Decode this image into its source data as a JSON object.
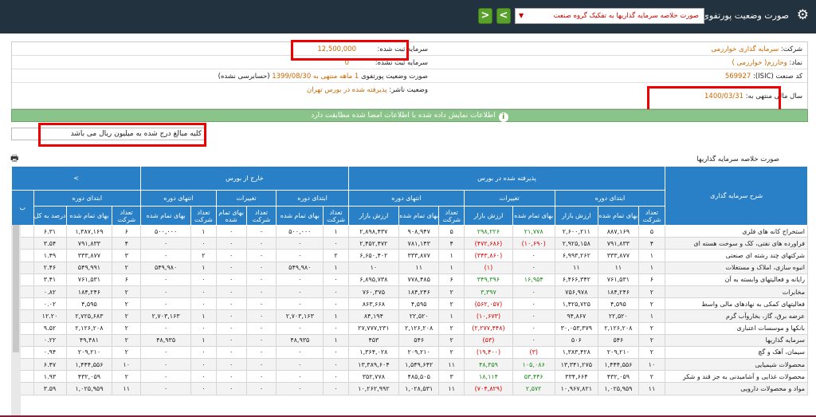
{
  "header": {
    "title": "صورت وضعیت پورتفوی",
    "report_select": "صورت خلاصه سرمایه گذاریها به تفکیک گروه صنعت",
    "prev": "<",
    "next": ">"
  },
  "info": {
    "company_label": "شرکت:",
    "company_value": "سرمایه گذاری خوارزمی",
    "registered_capital_label": "سرمایه ثبت شده:",
    "registered_capital_value": "12,500,000",
    "symbol_label": "نماد:",
    "symbol_value": "وخارزم( خوارزمی )",
    "unregistered_capital_label": "سرمایه ثبت نشده:",
    "unregistered_capital_value": "0",
    "isic_label": "کد صنعت (ISIC):",
    "isic_value": "569927",
    "portfolio_label": "صورت وضعیت پورتفوی",
    "portfolio_value": "1 ماهه منتهی به 1399/08/30",
    "portfolio_note": "(حسابرسی نشده)",
    "fiscal_label": "سال مالی منتهی به:",
    "fiscal_value": "1400/03/31",
    "status_label": "وضعیت ناشر:",
    "status_value": "پذیرفته شده در بورس تهران"
  },
  "notice": "اطلاعات نمایش داده شده با اطلاعات امضا شده مطابقت دارد",
  "unit_note": "کلیه مبالغ درج شده به میلیون ریال می باشد",
  "table_title": "صورت خلاصه سرمایه گذاریها",
  "headers": {
    "desc": "شرح سرمایه گذاری",
    "listed": "پذیرفته شده در بورس",
    "unlisted": "خارج از بورس",
    "start": "ابتدای دوره",
    "changes": "تغییرات",
    "end": "انتهای دوره",
    "count": "تعداد شرکت",
    "cost": "بهای تمام شده",
    "market": "ارزش بازار",
    "pct": "درصد به کل",
    "cut": "ب"
  },
  "rows": [
    {
      "name": "استخراج کانه های فلزی",
      "c": [
        "۵",
        "۸۸۷,۱۶۹",
        "۲,۶۰۰,۲۱۱",
        "۲۱,۷۷۸",
        "۲۹۸,۲۲۶",
        "۵",
        "۹۰۸,۹۴۷",
        "۲,۸۹۸,۴۳۷",
        "۱",
        "۵۰۰,۰۰۰",
        "۰",
        "۰",
        "۱",
        "۵۰۰,۰۰۰",
        "۶",
        "۱,۳۸۷,۱۶۹",
        "۶.۳۱"
      ]
    },
    {
      "name": "فراورده های نفتی، کک و سوخت هسته ای",
      "c": [
        "۴",
        "۷۹۱,۸۳۳",
        "۲,۹۲۵,۱۵۸",
        "(۱۰,۶۹۰)",
        "(۴۷۲,۶۸۶)",
        "۴",
        "۷۸۱,۱۴۳",
        "۲,۴۵۲,۴۷۲",
        "۰",
        "۰",
        "۰",
        "۰",
        "۰",
        "۰",
        "۴",
        "۷۹۱,۸۳۳",
        "۳.۵۴"
      ]
    },
    {
      "name": "شرکتهای چند رشته ای صنعتی",
      "c": [
        "۱",
        "۳۳۳,۸۷۷",
        "۶,۹۹۳,۲۶۲",
        "۰",
        "(۳۴۳,۸۶۰)",
        "۱",
        "۳۳۳,۸۷۷",
        "۶,۶۵۰,۴۰۲",
        "۲",
        "۰",
        "۰",
        "۰",
        "۲",
        "۰",
        "۳",
        "۳۳۳,۸۷۷",
        "۱.۴۹"
      ]
    },
    {
      "name": "انبوه سازی، املاک و مستغلات",
      "c": [
        "۱",
        "۱۱",
        "۱۱",
        "۰",
        "(۱)",
        "۱",
        "۱۱",
        "۱۰",
        "۱",
        "۵۴۹,۹۸۰",
        "۰",
        "۰",
        "۱",
        "۵۴۹,۹۸۰",
        "۲",
        "۵۴۹,۹۹۱",
        "۲.۴۶"
      ]
    },
    {
      "name": "رایانه و فعالیتهای وابسته به آن",
      "c": [
        "۶",
        "۷۶۱,۵۳۱",
        "۶,۴۶۶,۳۴۲",
        "۱۶,۹۵۴",
        "۳۴۹,۳۹۶",
        "۶",
        "۷۷۸,۴۸۵",
        "۶,۸۹۵,۷۳۸",
        "۰",
        "۰",
        "۰",
        "۰",
        "۰",
        "۰",
        "۶",
        "۷۶۱,۵۳۱",
        "۳.۴۱"
      ]
    },
    {
      "name": "مخابرات",
      "c": [
        "۲",
        "۱۸۴,۲۴۶",
        "۷۵۶,۹۷۸",
        "۰",
        "۳,۳۹۷",
        "۲",
        "۱۸۴,۲۴۶",
        "۷۶۰,۳۷۵",
        "۰",
        "۰",
        "۰",
        "۰",
        "۰",
        "۰",
        "۲",
        "۱۸۴,۲۴۶",
        "۰.۸۲"
      ]
    },
    {
      "name": "فعالیتهای کمکی به نهادهای مالی واسط",
      "c": [
        "۲",
        "۴,۵۹۵",
        "۱,۴۲۵,۷۲۵",
        "۰",
        "(۵۶۲,۰۵۷)",
        "۲",
        "۴,۵۹۵",
        "۸۶۳,۶۶۸",
        "۰",
        "۰",
        "۰",
        "۰",
        "۰",
        "۰",
        "۲",
        "۴,۵۹۵",
        "۰.۰۲"
      ]
    },
    {
      "name": "عرضه برق، گاز، بخاروآب گرم",
      "c": [
        "۱",
        "۲۲,۵۲۰",
        "۹۴,۸۶۷",
        "۰",
        "(۱۰,۶۷۳)",
        "۱",
        "۲۲,۵۲۰",
        "۸۴,۱۹۴",
        "۱",
        "۲,۷۰۳,۱۶۳",
        "۰",
        "۰",
        "۱",
        "۲,۷۰۳,۱۶۳",
        "۲",
        "۲,۷۲۵,۶۸۳",
        "۱۲.۲۰"
      ]
    },
    {
      "name": "بانکها و موسسات اعتباری",
      "c": [
        "۲",
        "۲,۱۲۶,۲۰۸",
        "۳۰,۰۵۳,۳۷۹",
        "۰",
        "(۲,۲۷۷,۴۴۸)",
        "۲",
        "۲,۱۲۶,۲۰۸",
        "۲۷,۷۷۷,۲۳۱",
        "۰",
        "۰",
        "۰",
        "۰",
        "۰",
        "۰",
        "۲",
        "۲,۱۲۶,۲۰۸",
        "۹.۵۲"
      ]
    },
    {
      "name": "سرمایه گذاریها",
      "c": [
        "۲",
        "۵۴۶",
        "۵۰۶",
        "۰",
        "(۵۳)",
        "۲",
        "۵۴۶",
        "۴۵۳",
        "۱",
        "۴۸,۹۳۵",
        "۰",
        "۰",
        "۱",
        "۴۸,۹۳۵",
        "۲",
        "۴۹,۴۸۱",
        "۰.۲۲"
      ]
    },
    {
      "name": "سیمان، آهک و گچ",
      "c": [
        "۲",
        "۲۰۹,۲۱۰",
        "۱,۳۸۳,۴۲۸",
        "(۳)",
        "(۱۹,۴۰۰)",
        "۲",
        "۲۰۹,۲۱۰",
        "۱,۳۶۴,۰۲۸",
        "۰",
        "۰",
        "۰",
        "۰",
        "۰",
        "۰",
        "۲",
        "۲۰۹,۲۱۰",
        "۰.۹۴"
      ]
    },
    {
      "name": "محصولات شیمیایی",
      "c": [
        "۱۰",
        "۱,۴۴۴,۵۵۶",
        "۱۳,۳۴۱,۲۷۵",
        "۱۰۵,۰۸۶",
        "۴۸,۳۵۹",
        "۱۱",
        "۱,۵۴۹,۶۴۲",
        "۱۳,۳۸۹,۶۰۴",
        "۰",
        "۰",
        "۰",
        "۰",
        "۰",
        "۰",
        "۱۰",
        "۱,۴۴۴,۵۵۶",
        "۶.۴۷"
      ]
    },
    {
      "name": "محصولات غذایی و آشامیدنی به جز قند و شکر",
      "c": [
        "۲",
        "۴۳۲,۰۵۹",
        "۳۳۴,۶۶۴",
        "۵۳,۴۴۶",
        "۱۸,۱۱۴",
        "۳",
        "۴۸۵,۵۰۵",
        "۳۵۲,۷۷۸",
        "۰",
        "۰",
        "۰",
        "۰",
        "۰",
        "۰",
        "۲",
        "۴۳۲,۰۵۹",
        "۱.۹۳"
      ]
    },
    {
      "name": "مواد و محصولات دارویی",
      "c": [
        "۱۱",
        "۱,۰۲۵,۹۵۹",
        "۱۰,۹۶۷,۸۲۱",
        "۲,۵۷۲",
        "(۷۰۴,۸۲۹)",
        "۱۱",
        "۱,۰۲۸,۵۳۱",
        "۱۰,۲۶۲,۹۹۲",
        "۰",
        "۰",
        "۰",
        "۰",
        "۰",
        "۰",
        "۱۱",
        "۱,۰۲۵,۹۵۹",
        "۳.۵۹"
      ]
    }
  ],
  "colors": {
    "header_blue": "#2a80c6",
    "top_bar": "#23323f",
    "notice_green": "#8bc48b",
    "highlight_red": "#e00000",
    "value_orange": "#cc6600"
  }
}
